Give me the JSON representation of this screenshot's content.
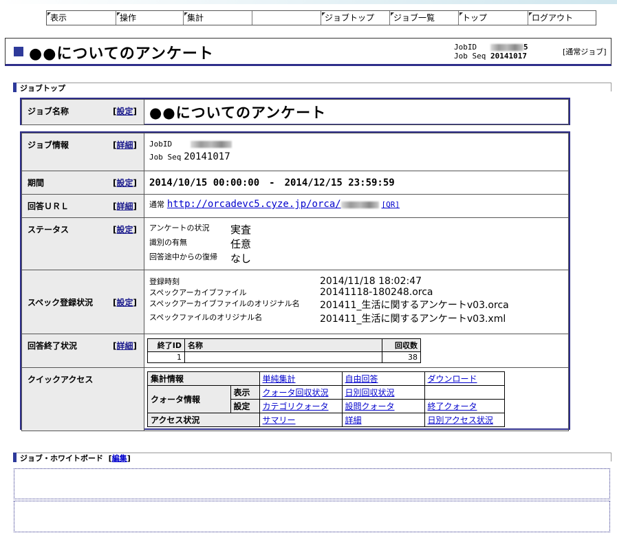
{
  "nav": {
    "items": [
      {
        "label": "表示",
        "link": true
      },
      {
        "label": "操作",
        "link": true
      },
      {
        "label": "集計",
        "link": true
      },
      {
        "label": "",
        "link": false
      },
      {
        "label": "ジョブトップ",
        "link": true
      },
      {
        "label": "ジョブ一覧",
        "link": true
      },
      {
        "label": "トップ",
        "link": true
      },
      {
        "label": "ログアウト",
        "link": true
      }
    ]
  },
  "header": {
    "title": "●●についてのアンケート",
    "jobid_label": "JobID",
    "jobid_suffix": "5",
    "jobseq_label": "Job Seq",
    "jobseq_value": "20141017",
    "job_type": "[通常ジョブ]"
  },
  "section_top": {
    "label": "ジョブトップ"
  },
  "job_name": {
    "label": "ジョブ名称",
    "action": "設定",
    "value": "●●についてのアンケート"
  },
  "job_info": {
    "label": "ジョブ情報",
    "action": "詳細",
    "jobid_label": "JobID",
    "jobseq_label": "Job Seq",
    "jobseq_value": "20141017"
  },
  "period": {
    "label": "期間",
    "action": "設定",
    "value": "2014/10/15 00:00:00　-　2014/12/15 23:59:59"
  },
  "answer_url": {
    "label": "回答ＵＲＬ",
    "action": "詳細",
    "prefix": "通常",
    "url": "http://orcadevc5.cyze.jp/orca/",
    "qr": "[QR]"
  },
  "status": {
    "label": "ステータス",
    "action": "設定",
    "rows": [
      {
        "key": "アンケートの状況",
        "value": "実査"
      },
      {
        "key": "識別の有無",
        "value": "任意"
      },
      {
        "key": "回答途中からの復帰",
        "value": "なし"
      }
    ]
  },
  "spec": {
    "label": "スペック登録状況",
    "action": "設定",
    "rows": [
      {
        "key": "登録時刻",
        "value": "2014/11/18 18:02:47"
      },
      {
        "key": "スペックアーカイブファイル",
        "value": "20141118-180248.orca"
      },
      {
        "key": "スペックアーカイブファイルのオリジナル名",
        "value": "201411_生活に関するアンケートv03.orca"
      },
      {
        "key": "スペックファイルのオリジナル名",
        "value": "201411_生活に関するアンケートv03.xml"
      }
    ]
  },
  "end_status": {
    "label": "回答終了状況",
    "action": "詳細",
    "headers": [
      "終了ID",
      "名称",
      "回収数"
    ],
    "rows": [
      {
        "id": "1",
        "name": "",
        "count": "38"
      }
    ]
  },
  "quick": {
    "label": "クイックアクセス",
    "agg_label": "集計情報",
    "agg_links": [
      "単純集計",
      "自由回答",
      "ダウンロード"
    ],
    "quota_label": "クォータ情報",
    "quota_view_label": "表示",
    "quota_view_links": [
      "クォータ回収状況",
      "日別回収状況",
      ""
    ],
    "quota_set_label": "設定",
    "quota_set_links": [
      "カテゴリクォータ",
      "設問クォータ",
      "終了クォータ"
    ],
    "access_label": "アクセス状況",
    "access_links": [
      "サマリー",
      "詳細",
      "日別アクセス状況"
    ]
  },
  "whiteboard": {
    "label": "ジョブ・ホワイトボード",
    "action": "編集"
  }
}
